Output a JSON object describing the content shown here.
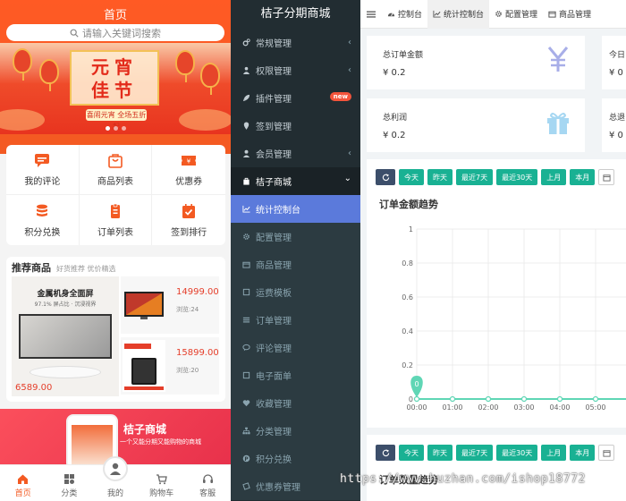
{
  "mobile": {
    "title": "首页",
    "search_placeholder": "请输入关键词搜索",
    "banner": {
      "line1": "元宵",
      "line2": "佳节",
      "sub": "喜闹元宵 全场五折起"
    },
    "grid": [
      {
        "label": "我的评论",
        "icon": "comment-icon"
      },
      {
        "label": "商品列表",
        "icon": "shopping-bag-icon"
      },
      {
        "label": "优惠券",
        "icon": "coupon-icon"
      },
      {
        "label": "积分兑换",
        "icon": "database-icon"
      },
      {
        "label": "订单列表",
        "icon": "clipboard-icon"
      },
      {
        "label": "签到排行",
        "icon": "calendar-check-icon"
      }
    ],
    "recommend": {
      "title": "推荐商品",
      "subtitle": "好货推荐 优价精选",
      "big": {
        "title": "金属机身全面屏",
        "subtitle": "97.1% 屏占比 · 沉浸视界",
        "price": "6589.00"
      },
      "cards": [
        {
          "price": "14999.00",
          "views": "浏览:24"
        },
        {
          "price": "15899.00",
          "views": "浏览:20"
        }
      ]
    },
    "promo": {
      "title": "桔子商城",
      "subtitle": "一个又能分期又能购物的商城"
    },
    "tabs": [
      {
        "label": "首页",
        "icon": "home-icon"
      },
      {
        "label": "分类",
        "icon": "category-icon"
      },
      {
        "label": "我的",
        "icon": "user-icon"
      },
      {
        "label": "购物车",
        "icon": "cart-icon"
      },
      {
        "label": "客服",
        "icon": "headset-icon"
      }
    ]
  },
  "sidebar": {
    "title": "桔子分期商城",
    "items": [
      {
        "label": "常规管理",
        "icon": "cogs-icon",
        "arrow": "‹"
      },
      {
        "label": "权限管理",
        "icon": "group-icon",
        "arrow": "‹"
      },
      {
        "label": "插件管理",
        "icon": "rocket-icon",
        "badge": "new"
      },
      {
        "label": "签到管理",
        "icon": "map-pin-icon"
      },
      {
        "label": "会员管理",
        "icon": "user-icon",
        "arrow": "‹"
      },
      {
        "label": "桔子商城",
        "icon": "shopping-bag-icon",
        "arrow": "⌄"
      },
      {
        "label": "统计控制台",
        "icon": "line-chart-icon"
      },
      {
        "label": "配置管理",
        "icon": "gear-icon"
      },
      {
        "label": "商品管理",
        "icon": "box-icon"
      },
      {
        "label": "运费模板",
        "icon": "square-icon"
      },
      {
        "label": "订单管理",
        "icon": "list-icon"
      },
      {
        "label": "评论管理",
        "icon": "comment-icon"
      },
      {
        "label": "电子面单",
        "icon": "square-icon"
      },
      {
        "label": "收藏管理",
        "icon": "heart-icon"
      },
      {
        "label": "分类管理",
        "icon": "sitemap-icon"
      },
      {
        "label": "积分兑换",
        "icon": "pinterest-icon"
      },
      {
        "label": "优惠券管理",
        "icon": "ticket-icon"
      }
    ]
  },
  "topbar": {
    "tabs": [
      {
        "label": "控制台",
        "icon": "dashboard-icon"
      },
      {
        "label": "统计控制台",
        "icon": "line-chart-icon"
      },
      {
        "label": "配置管理",
        "icon": "gear-icon"
      },
      {
        "label": "商品管理",
        "icon": "box-icon"
      }
    ]
  },
  "stats": {
    "total_order_label": "总订单金额",
    "total_order_value": "¥ 0.2",
    "today_label": "今日",
    "today_value": "¥ 0",
    "profit_label": "总利润",
    "profit_value": "¥ 0.2",
    "refund_label": "总退",
    "refund_value": "¥ 0"
  },
  "filters": [
    "今天",
    "昨天",
    "最近7天",
    "最近30天",
    "上月",
    "本月"
  ],
  "chart_data": {
    "type": "line",
    "title": "订单金额趋势",
    "x": [
      "00:00",
      "01:00",
      "02:00",
      "03:00",
      "04:00",
      "05:00"
    ],
    "series": [
      {
        "values": [
          0,
          0,
          0,
          0,
          0,
          0
        ]
      }
    ],
    "ylim": [
      0,
      1
    ],
    "yticks": [
      "0",
      "0.2",
      "0.4",
      "0.6",
      "0.8",
      "1"
    ],
    "markpoint": "0",
    "grid": true
  },
  "chart2_title": "订单数量趋势",
  "watermark": "https://www.huzhan.com/ishop18772",
  "colors": {
    "orange": "#f35a22",
    "sidebar": "#222d32",
    "active": "#5b7adb",
    "green": "#19b193"
  }
}
